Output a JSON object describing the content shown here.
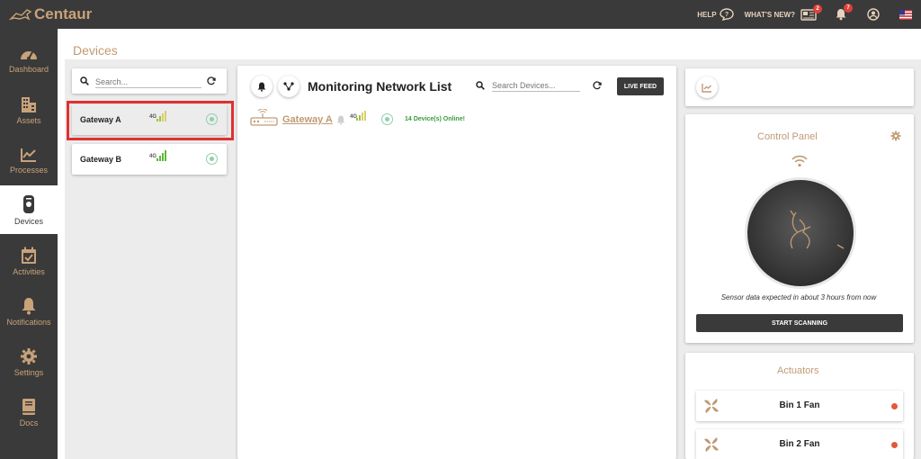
{
  "app": {
    "brand": "Centaur"
  },
  "topbar": {
    "help_label": "HELP",
    "whats_new_label": "WHAT'S NEW?",
    "whats_new_badge": "2",
    "notifications_badge": "7"
  },
  "sidebar": {
    "items": [
      {
        "label": "Dashboard"
      },
      {
        "label": "Assets"
      },
      {
        "label": "Processes"
      },
      {
        "label": "Devices"
      },
      {
        "label": "Activities"
      },
      {
        "label": "Notifications"
      },
      {
        "label": "Settings"
      },
      {
        "label": "Docs"
      }
    ]
  },
  "page": {
    "title": "Devices"
  },
  "device_list": {
    "search_placeholder": "Search...",
    "gateways": [
      {
        "name": "Gateway A",
        "network": "4G"
      },
      {
        "name": "Gateway B",
        "network": "4G"
      }
    ]
  },
  "monitor": {
    "title": "Monitoring Network List",
    "search_placeholder": "Search Devices...",
    "live_feed_label": "LIVE FEED",
    "gateway_name": "Gateway A",
    "gateway_network": "4G",
    "online_text": "14 Device(s) Online!"
  },
  "control_panel": {
    "title": "Control Panel",
    "sensor_text": "Sensor data expected in about 3 hours from now",
    "scan_label": "START SCANNING"
  },
  "actuators": {
    "title": "Actuators",
    "items": [
      {
        "label": "Bin 1 Fan"
      },
      {
        "label": "Bin 2 Fan"
      }
    ]
  },
  "colors": {
    "brand": "#c09a74",
    "dark": "#3a3a3a",
    "online_green": "#3a9a3a",
    "status_red": "#e05a3a"
  }
}
